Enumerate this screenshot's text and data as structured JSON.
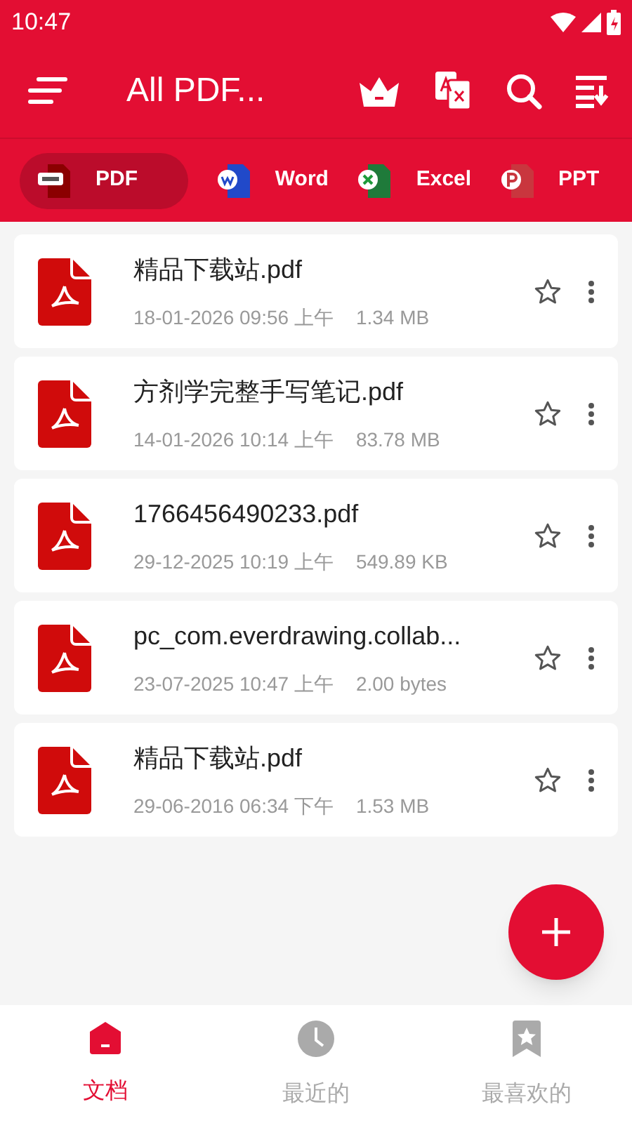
{
  "status_bar": {
    "time": "10:47"
  },
  "toolbar": {
    "title": "All PDF..."
  },
  "filter_tabs": [
    {
      "label": "PDF",
      "kind": "pdf",
      "selected": true
    },
    {
      "label": "Word",
      "kind": "word",
      "selected": false
    },
    {
      "label": "Excel",
      "kind": "excel",
      "selected": false
    },
    {
      "label": "PPT",
      "kind": "ppt",
      "selected": false
    }
  ],
  "files": [
    {
      "name": "精品下载站.pdf",
      "date": "18-01-2026 09:56 上午",
      "size": "1.34 MB",
      "starred": false
    },
    {
      "name": "方剂学完整手写笔记.pdf",
      "date": "14-01-2026 10:14 上午",
      "size": "83.78 MB",
      "starred": false
    },
    {
      "name": "1766456490233.pdf",
      "date": "29-12-2025 10:19 上午",
      "size": "549.89 KB",
      "starred": false
    },
    {
      "name": "pc_com.everdrawing.collab...",
      "date": "23-07-2025 10:47 上午",
      "size": "2.00 bytes",
      "starred": false
    },
    {
      "name": "精品下载站.pdf",
      "date": "29-06-2016 06:34 下午",
      "size": "1.53 MB",
      "starred": false
    }
  ],
  "bottom_nav": [
    {
      "label": "文档",
      "kind": "home",
      "selected": true
    },
    {
      "label": "最近的",
      "kind": "clock",
      "selected": false
    },
    {
      "label": "最喜欢的",
      "kind": "bookmark",
      "selected": false
    }
  ]
}
